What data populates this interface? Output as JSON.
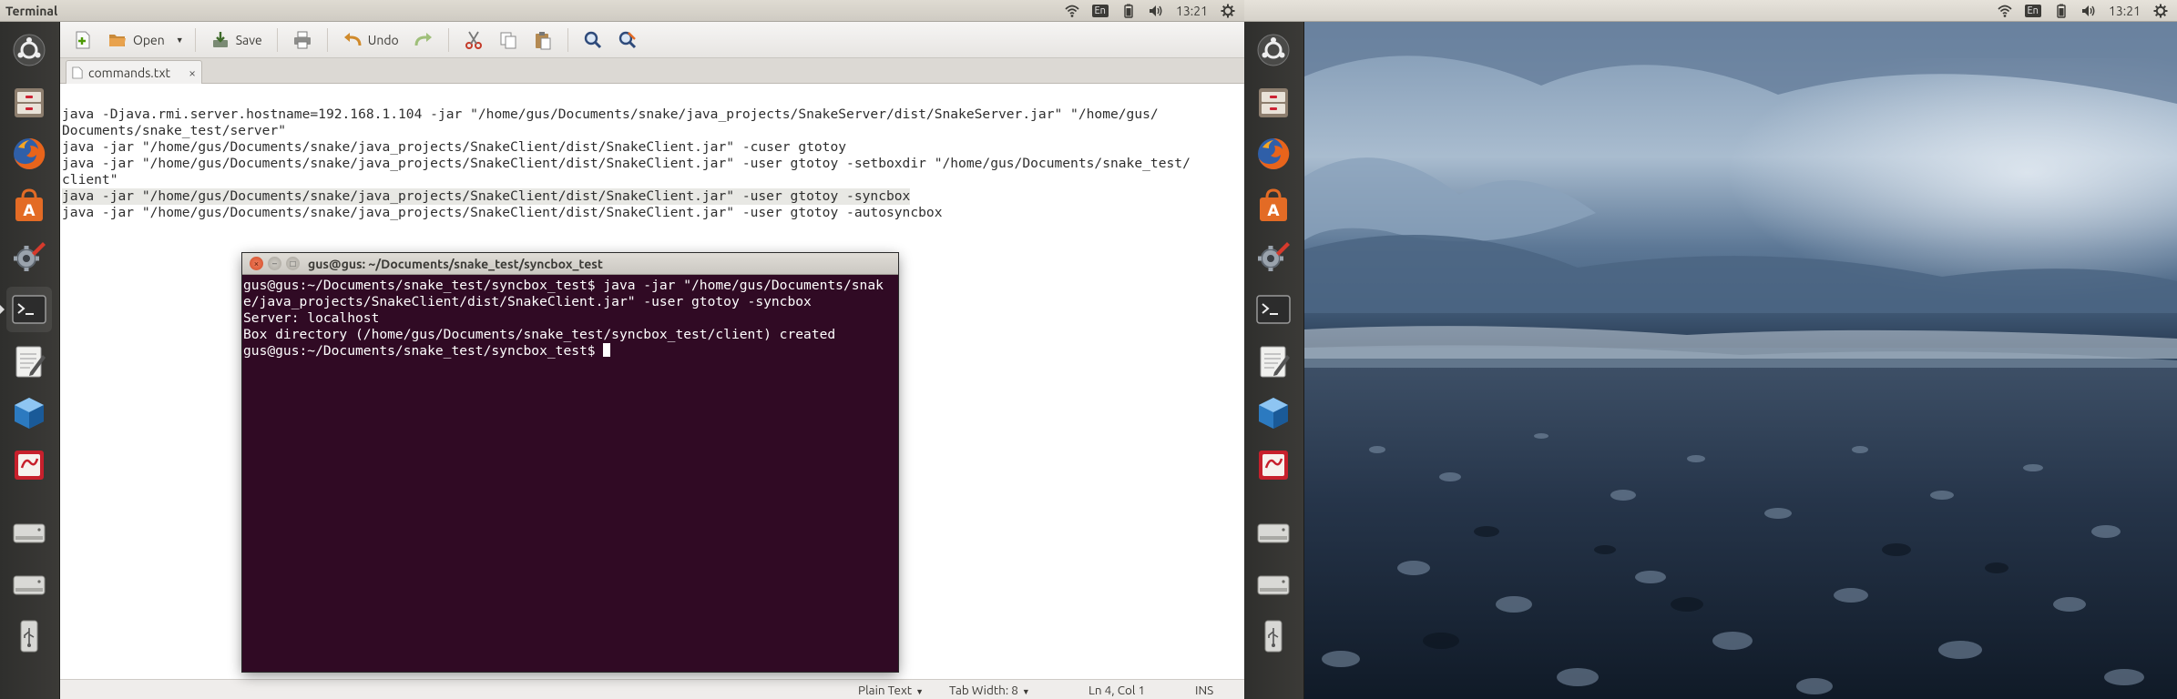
{
  "left_panel": {
    "app_title": "Terminal",
    "lang": "En",
    "clock": "13:21"
  },
  "right_panel": {
    "lang": "En",
    "clock": "13:21"
  },
  "launcher_items": [
    {
      "name": "dash-home",
      "icon": "ubuntu-logo-icon"
    },
    {
      "name": "files",
      "icon": "file-cabinet-icon"
    },
    {
      "name": "firefox",
      "icon": "firefox-icon"
    },
    {
      "name": "software-center",
      "icon": "shopping-bag-icon"
    },
    {
      "name": "system-settings",
      "icon": "gear-wrench-icon"
    },
    {
      "name": "terminal",
      "icon": "terminal-icon"
    },
    {
      "name": "text-editor",
      "icon": "notepad-pencil-icon"
    },
    {
      "name": "virtualbox",
      "icon": "cube-icon"
    },
    {
      "name": "pdf-viewer",
      "icon": "document-viewer-icon"
    },
    {
      "name": "drive-1",
      "icon": "hard-drive-icon"
    },
    {
      "name": "drive-2",
      "icon": "hard-drive-icon"
    },
    {
      "name": "usb-drive",
      "icon": "usb-icon"
    }
  ],
  "gedit": {
    "toolbar": {
      "open_label": "Open",
      "save_label": "Save",
      "undo_label": "Undo"
    },
    "tab_label": "commands.txt",
    "tab_close": "×",
    "lines": [
      "java -Djava.rmi.server.hostname=192.168.1.104 -jar \"/home/gus/Documents/snake/java_projects/SnakeServer/dist/SnakeServer.jar\" \"/home/gus/",
      "Documents/snake_test/server\"",
      "java -jar \"/home/gus/Documents/snake/java_projects/SnakeClient/dist/SnakeClient.jar\" -cuser gtotoy",
      "java -jar \"/home/gus/Documents/snake/java_projects/SnakeClient/dist/SnakeClient.jar\" -user gtotoy -setboxdir \"/home/gus/Documents/snake_test/",
      "client\"",
      "java -jar \"/home/gus/Documents/snake/java_projects/SnakeClient/dist/SnakeClient.jar\" -user gtotoy -syncbox",
      "java -jar \"/home/gus/Documents/snake/java_projects/SnakeClient/dist/SnakeClient.jar\" -user gtotoy -autosyncbox"
    ],
    "status": {
      "language": "Plain Text",
      "tab_width": "Tab Width: 8",
      "position": "Ln 4, Col 1",
      "mode": "INS"
    }
  },
  "terminal": {
    "title": "gus@gus: ~/Documents/snake_test/syncbox_test",
    "lines": [
      "gus@gus:~/Documents/snake_test/syncbox_test$ java -jar \"/home/gus/Documents/snak",
      "e/java_projects/SnakeClient/dist/SnakeClient.jar\" -user gtotoy -syncbox",
      "Server: localhost",
      "Box directory (/home/gus/Documents/snake_test/syncbox_test/client) created"
    ],
    "prompt": "gus@gus:~/Documents/snake_test/syncbox_test$ "
  }
}
